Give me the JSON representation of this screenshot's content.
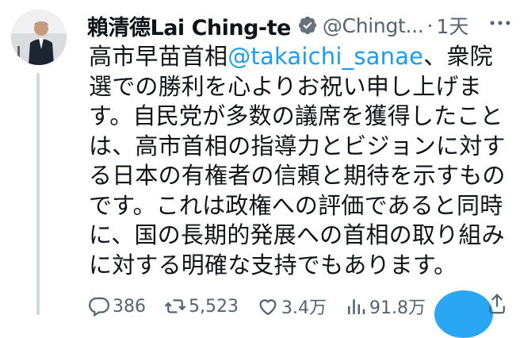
{
  "author": {
    "name": "賴清德Lai Ching-te",
    "handle": "@Chingt...",
    "separator": "·",
    "time": "1天",
    "avatar_icon": "user-portrait-avatar",
    "verified_icon": "verified-badge-icon"
  },
  "post": {
    "text_before": "高市早苗首相",
    "mention": "@takaichi_sanae",
    "text_after": "、衆院選での勝利を心よりお祝い申し上げます。自民党が多数の議席を獲得したことは、高市首相の指導力とビジョンに対する日本の有権者の信頼と期待を示すものです。これは政権への評価であると同時に、国の長期的発展への首相の取り組みに対する明確な支持でもあります。"
  },
  "actions": {
    "replies": "386",
    "reposts": "5,523",
    "likes": "3.4万",
    "views": "91.8万"
  },
  "colors": {
    "text": "#0f1419",
    "muted": "#536471",
    "accent": "#1d9bf0",
    "thread_line": "#cfd9de"
  }
}
